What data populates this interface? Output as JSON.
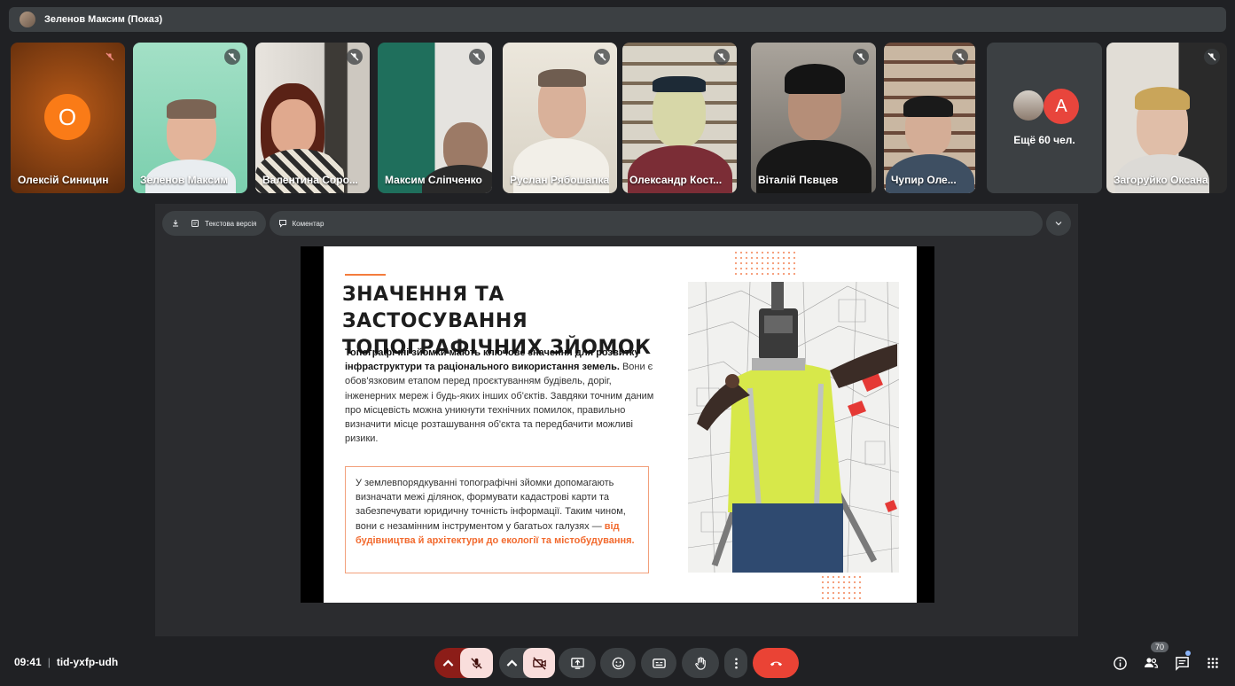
{
  "presenter_bar": {
    "title": "Зеленов Максим (Показ)"
  },
  "participants": [
    {
      "name": "Олексій Синицин",
      "initial": "О"
    },
    {
      "name": "Зеленов Максим"
    },
    {
      "name": "Валентина Соро..."
    },
    {
      "name": "Максим Сліпченко"
    },
    {
      "name": "Руслан Рябошапка"
    },
    {
      "name": "Олександр Кост..."
    },
    {
      "name": "Віталій Пєвцев"
    },
    {
      "name": "Чупир Оле..."
    },
    {
      "name": "Загоруйко Оксана"
    }
  ],
  "more_tile": {
    "label": "Ещё 60 чел.",
    "initial": "A"
  },
  "stage_toolbar": {
    "text_version": "Текстова версія",
    "comment": "Коментар"
  },
  "slide": {
    "title": "ЗНАЧЕННЯ ТА ЗАСТОСУВАННЯ ТОПОГРАФІЧНИХ ЗЙОМОК",
    "para_bold": "Топографічні зйомки мають ключове значення для розвитку інфраструктури та раціонального використання земель.",
    "para_rest": " Вони є обов'язковим етапом перед проєктуванням будівель, доріг, інженерних мереж і будь-яких інших об'єктів. Завдяки точним даним про місцевість можна уникнути технічних помилок, правильно визначити місце розташування об'єкта та передбачити можливі ризики.",
    "box_text": "У землевпорядкуванні топографічні зйомки допомагають визначати межі ділянок, формувати кадастрові карти та забезпечувати юридичну точність інформації. Таким чином, вони є незамінним інструментом у багатьох галузях — ",
    "box_highlight": "від будівництва й архітектури до екології та містобудування."
  },
  "meeting": {
    "time": "09:41",
    "separator": "|",
    "code": "tid-yxfp-udh"
  },
  "participants_count": "70",
  "colors": {
    "end_call": "#ea4335",
    "muted_bg": "#f9dedc",
    "accent": "#f47c3c"
  }
}
